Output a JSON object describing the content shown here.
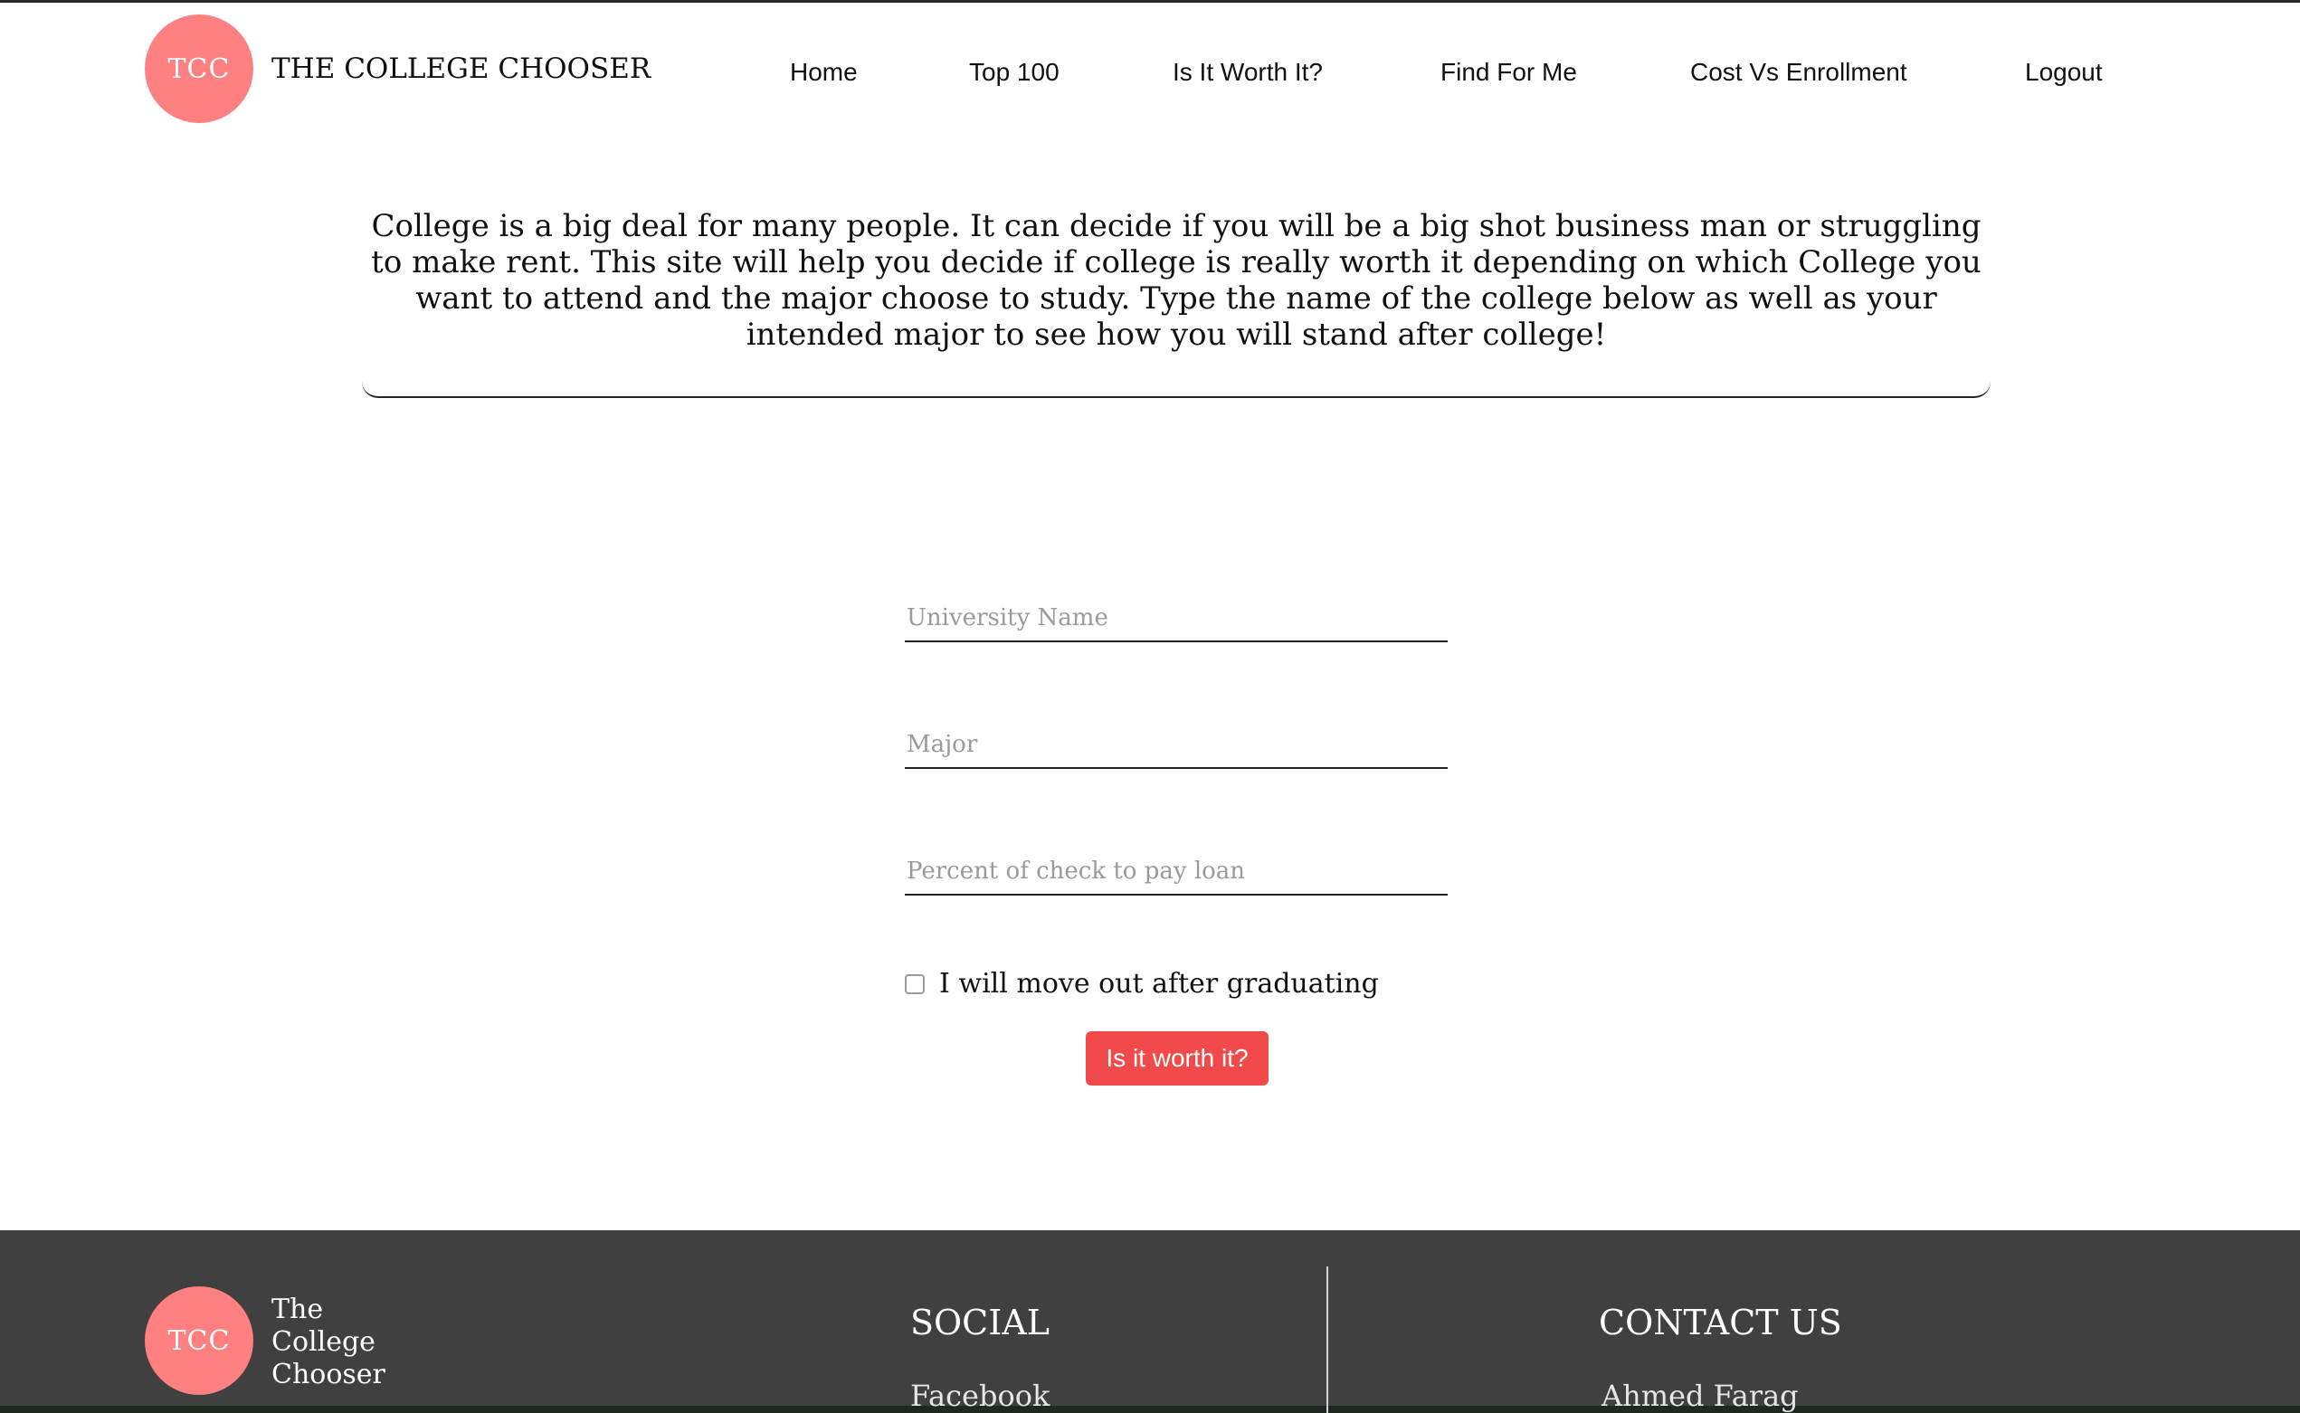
{
  "header": {
    "logo_text": "TCC",
    "brand_title": "THE COLLEGE CHOOSER",
    "nav": [
      {
        "label": "Home"
      },
      {
        "label": "Top 100"
      },
      {
        "label": "Is It Worth It?"
      },
      {
        "label": "Find For Me"
      },
      {
        "label": "Cost Vs Enrollment"
      },
      {
        "label": "Logout"
      }
    ]
  },
  "intro": {
    "text": "College is a big deal for many people. It can decide if you will be a big shot business man or struggling to make rent. This site will help you decide if college is really worth it depending on which College you want to attend and the major choose to study. Type the name of the college below as well as your intended major to see how you will stand after college!"
  },
  "form": {
    "university": {
      "placeholder": "University Name",
      "value": ""
    },
    "major": {
      "placeholder": "Major",
      "value": ""
    },
    "percent": {
      "placeholder": "Percent of check to pay loan",
      "value": ""
    },
    "checkbox_label": "I will move out after graduating",
    "checkbox_checked": false,
    "submit_label": "Is it worth it?"
  },
  "footer": {
    "logo_text": "TCC",
    "brand_line1": "The",
    "brand_line2": "College",
    "brand_line3": "Chooser",
    "social_heading": "SOCIAL",
    "social_first_link": "Facebook",
    "contact_heading": "CONTACT US",
    "contact_first_entry": "Ahmed Farag"
  },
  "colors": {
    "accent": "#ff8080",
    "button": "#f24a4a",
    "footer_bg": "#404040"
  }
}
